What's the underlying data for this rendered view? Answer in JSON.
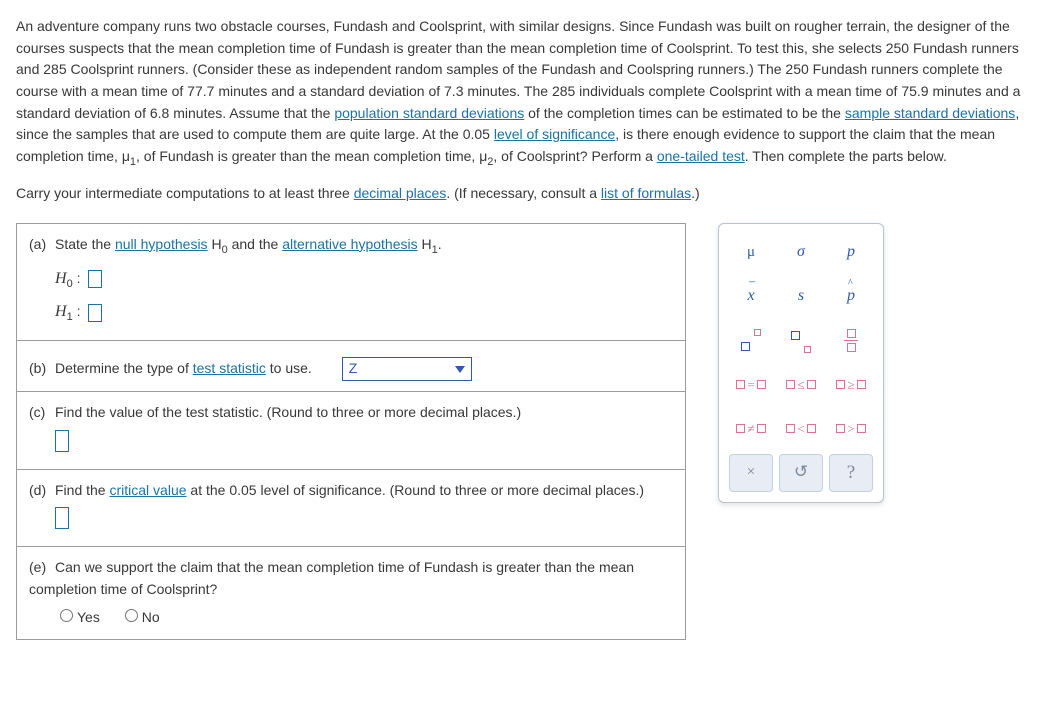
{
  "problem": {
    "p1": "An adventure company runs two obstacle courses, Fundash and Coolsprint, with similar designs. Since Fundash was built on rougher terrain, the designer of the courses suspects that the mean completion time of Fundash is greater than the mean completion time of Coolsprint. To test this, she selects 250 Fundash runners and 285 Coolsprint runners. (Consider these as independent random samples of the Fundash and Coolspring runners.) The 250 Fundash runners complete the course with a mean time of 77.7 minutes and a standard deviation of 7.3 minutes. The 285 individuals complete Coolsprint with a mean time of 75.9 minutes and a standard deviation of 6.8 minutes. Assume that the ",
    "link_psd": "population standard deviations",
    "p2": " of the completion times can be estimated to be the ",
    "link_ssd": "sample standard deviations",
    "p3": ", since the samples that are used to compute them are quite large. At the 0.05 ",
    "link_los": "level of significance",
    "p4": ", is there enough evidence to support the claim that the mean completion time, μ",
    "sub1": "1",
    "p5": ", of Fundash is greater than the mean completion time, μ",
    "sub2": "2",
    "p6": ", of Coolsprint? Perform a ",
    "link_ott": "one-tailed test",
    "p7": ". Then complete the parts below.",
    "carry_pre": "Carry your intermediate computations to at least three ",
    "link_dec": "decimal places",
    "carry_mid": ". (If necessary, consult a ",
    "link_for": "list of formulas",
    "carry_post": ".)"
  },
  "parts": {
    "a": {
      "label": "(a)",
      "text_pre": "State the ",
      "link_null": "null hypothesis",
      "text_mid": " H",
      "sub0": "0",
      "text_mid2": " and the ",
      "link_alt": "alternative hypothesis",
      "text_mid3": " H",
      "sub1": "1",
      "text_post": ".",
      "h0": "H",
      "h0sub": "0",
      "colon": " : ",
      "h1": "H",
      "h1sub": "1"
    },
    "b": {
      "label": "(b)",
      "text_pre": "Determine the type of ",
      "link_ts": "test statistic",
      "text_post": " to use.",
      "selected": "Z"
    },
    "c": {
      "label": "(c)",
      "text": "Find the value of the test statistic. (Round to three or more decimal places.)"
    },
    "d": {
      "label": "(d)",
      "text_pre": "Find the ",
      "link_cv": "critical value",
      "text_post": " at the 0.05 level of significance. (Round to three or more decimal places.)"
    },
    "e": {
      "label": "(e)",
      "text": "Can we support the claim that the mean completion time of Fundash is greater than the mean completion time of Coolsprint?",
      "yes": "Yes",
      "no": "No"
    }
  },
  "palette": {
    "mu": "μ",
    "sigma": "σ",
    "p": "p",
    "xbar": "x̄",
    "s": "s",
    "phat": "p̂",
    "eq": "=",
    "le": "≤",
    "ge": "≥",
    "ne": "≠",
    "lt": "<",
    "gt": ">",
    "times": "×",
    "undo": "↺",
    "help": "?"
  }
}
